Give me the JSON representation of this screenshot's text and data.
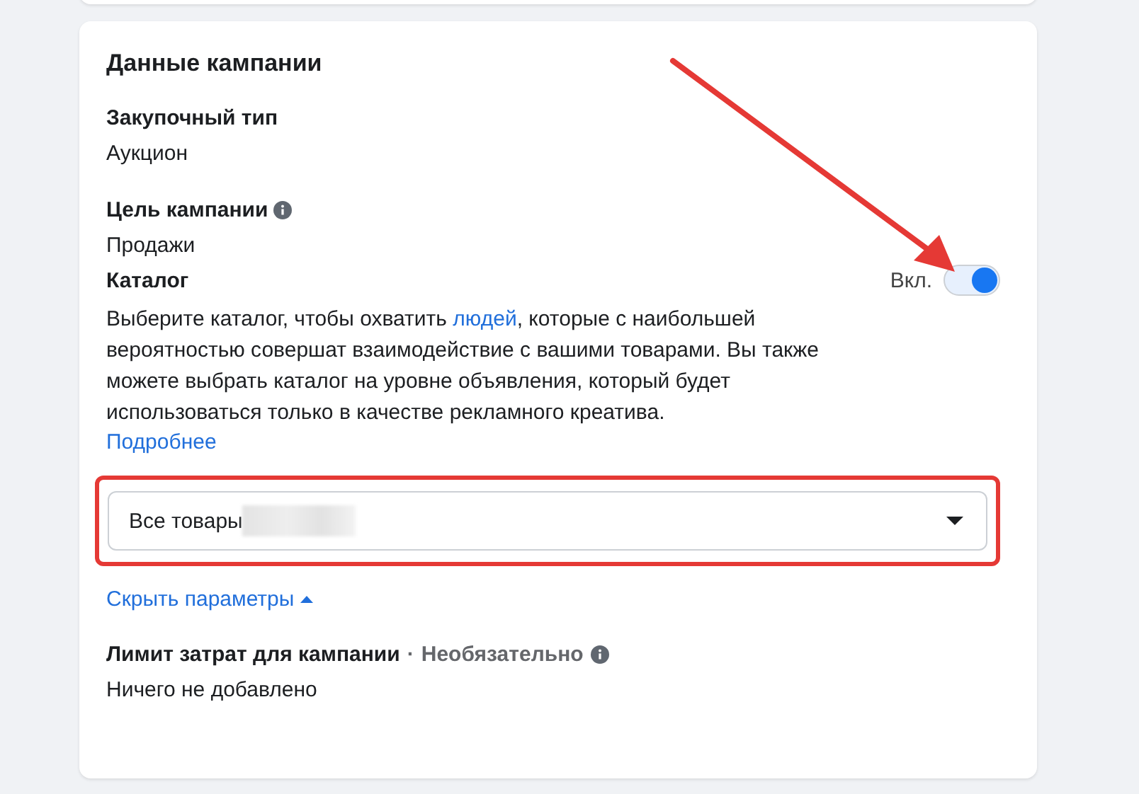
{
  "card": {
    "title": "Данные кампании",
    "fields": [
      {
        "label": "Закупочный тип",
        "value": "Аукцион",
        "info": false
      },
      {
        "label": "Цель кампании",
        "value": "Продажи",
        "info": true
      }
    ]
  },
  "catalog": {
    "label": "Каталог",
    "toggle": {
      "label": "Вкл.",
      "on": true
    },
    "description": {
      "before": "Выберите каталог, чтобы охватить ",
      "link": "людей",
      "after": ", которые с наибольшей вероятностью совершат взаимодействие с вашими товарами. Вы также можете выбрать каталог на уровне объявления, который будет использоваться только в качестве рекламного креатива."
    },
    "more_link": "Подробнее",
    "dropdown": {
      "value": "Все товары",
      "redacted": true
    },
    "highlighted": true
  },
  "hide_options": {
    "label": "Скрыть параметры",
    "expanded": true
  },
  "spend_limit": {
    "label": "Лимит затрат для кампании",
    "separator": "·",
    "optional": "Необязательно",
    "info": true,
    "value": "Ничего не добавлено"
  },
  "annotation": {
    "arrow": true
  }
}
